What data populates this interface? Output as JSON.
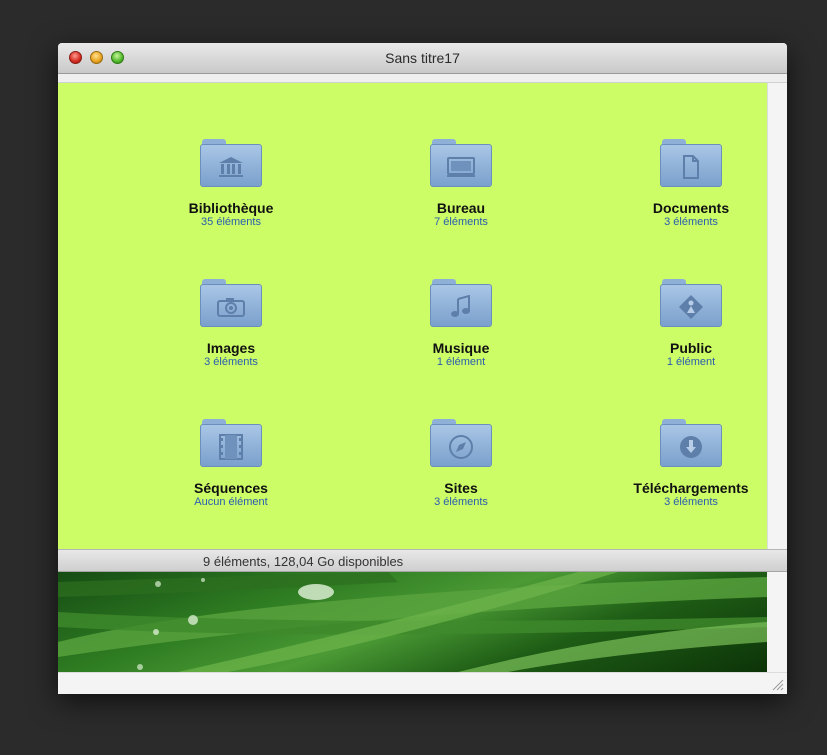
{
  "window": {
    "title": "Sans titre17"
  },
  "items": [
    {
      "name": "Bibliothèque",
      "count": "35 éléments",
      "icon": "library-icon"
    },
    {
      "name": "Bureau",
      "count": "7 éléments",
      "icon": "desktop-icon"
    },
    {
      "name": "Documents",
      "count": "3 éléments",
      "icon": "document-icon"
    },
    {
      "name": "Images",
      "count": "3 éléments",
      "icon": "camera-icon"
    },
    {
      "name": "Musique",
      "count": "1 élément",
      "icon": "music-icon"
    },
    {
      "name": "Public",
      "count": "1 élément",
      "icon": "public-icon"
    },
    {
      "name": "Séquences",
      "count": "Aucun élément",
      "icon": "film-icon"
    },
    {
      "name": "Sites",
      "count": "3 éléments",
      "icon": "compass-icon"
    },
    {
      "name": "Téléchargements",
      "count": "3 éléments",
      "icon": "download-icon"
    }
  ],
  "status": {
    "text": "9 éléments, 128,04 Go disponibles"
  },
  "colors": {
    "background": "#ccfc66",
    "folder": "#8fb0d6",
    "count_text": "#2a5db0"
  }
}
